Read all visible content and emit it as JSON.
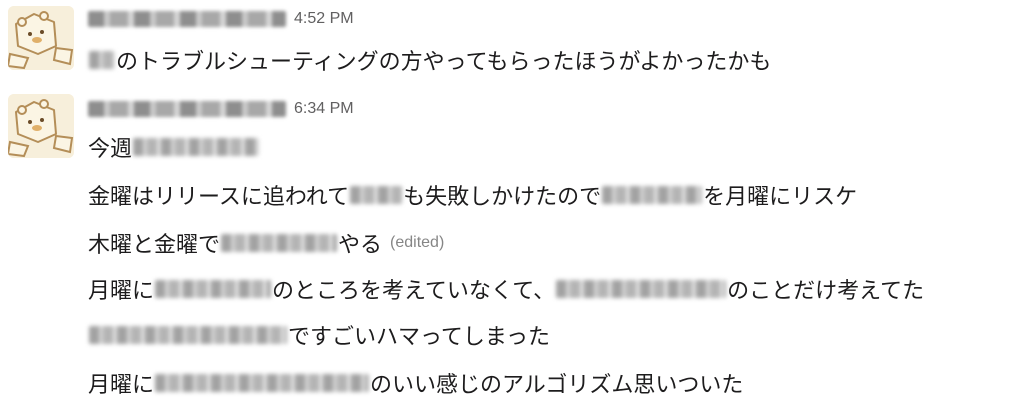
{
  "messages": [
    {
      "time": "4:52 PM",
      "lines": [
        {
          "after": "のトラブルシューティングの方やってもらったほうがよかったかも"
        }
      ]
    },
    {
      "time": "6:34 PM",
      "lines": [
        {
          "before": "今週"
        },
        {
          "before": "金曜はリリースに追われて",
          "middle": "も失敗しかけたので",
          "after": "を月曜にリスケ"
        },
        {
          "before": "木曜と金曜で",
          "after": "やる",
          "edited": "(edited)"
        },
        {
          "before": "月曜に",
          "middle": "のところを考えていなくて、",
          "after": "のことだけ考えてた"
        },
        {
          "after": "ですごいハマってしまった"
        },
        {
          "before": "月曜に",
          "after": "のいい感じのアルゴリズム思いついた"
        }
      ]
    }
  ]
}
